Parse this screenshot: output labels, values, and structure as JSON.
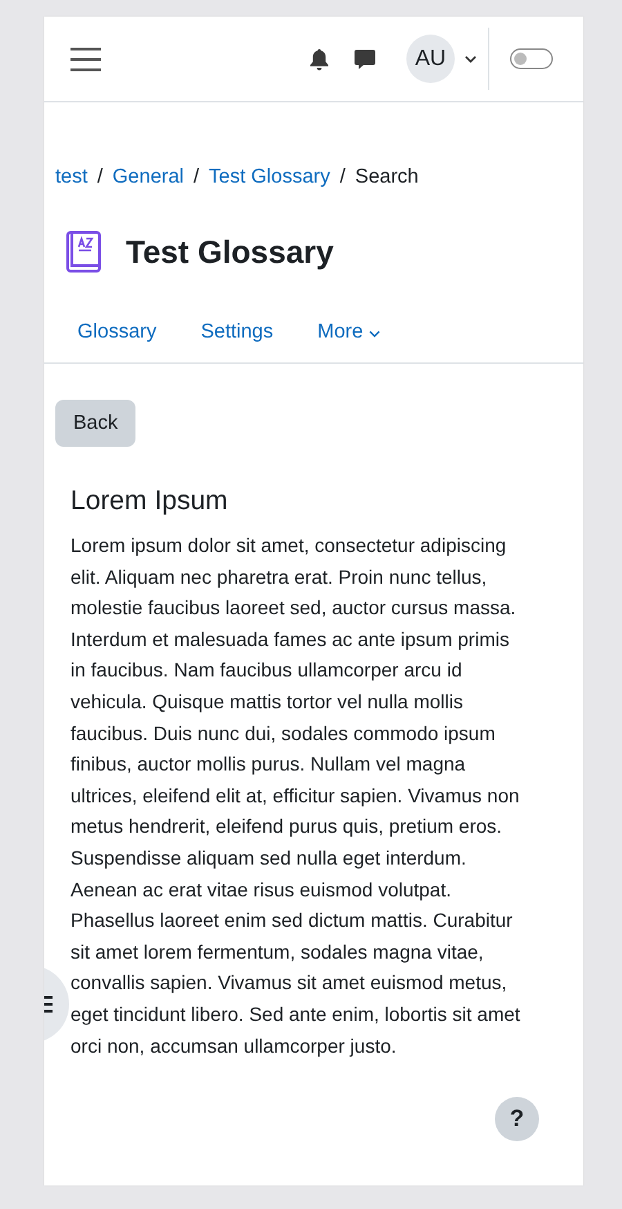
{
  "navbar": {
    "avatar": "AU",
    "edit_mode": {
      "on": false
    }
  },
  "breadcrumb": [
    {
      "label": "test",
      "link": true
    },
    {
      "label": "General",
      "link": true
    },
    {
      "label": "Test Glossary",
      "link": true
    },
    {
      "label": "Search",
      "link": false
    }
  ],
  "separator": "/",
  "title": "Test Glossary",
  "tabs": [
    {
      "label": "Glossary",
      "kind": "link"
    },
    {
      "label": "Settings",
      "kind": "link"
    },
    {
      "label": "More",
      "kind": "menu"
    }
  ],
  "back_button": "Back",
  "entry": {
    "heading": "Lorem Ipsum",
    "text": "Lorem ipsum dolor sit amet, consectetur adipiscing elit. Aliquam nec pharetra erat. Proin nunc tellus, molestie faucibus laoreet sed, auctor cursus massa. Interdum et malesuada fames ac ante ipsum primis in faucibus. Nam faucibus ullamcorper arcu id vehicula. Quisque mattis tortor vel nulla mollis faucibus. Duis nunc dui, sodales commodo ipsum finibus, auctor mollis purus. Nullam vel magna ultrices, eleifend elit at, efficitur sapien. Vivamus non metus hendrerit, eleifend purus quis, pretium eros. Suspendisse aliquam sed nulla eget interdum. Aenean ac erat vitae risus euismod volutpat. Phasellus laoreet enim sed dictum mattis. Curabitur sit amet lorem fermentum, sodales magna vitae, convallis sapien. Vivamus sit amet euismod metus, eget tincidunt libero. Sed ante enim, lobortis sit amet orci non, accumsan ullamcorper justo."
  },
  "help_button": "?"
}
